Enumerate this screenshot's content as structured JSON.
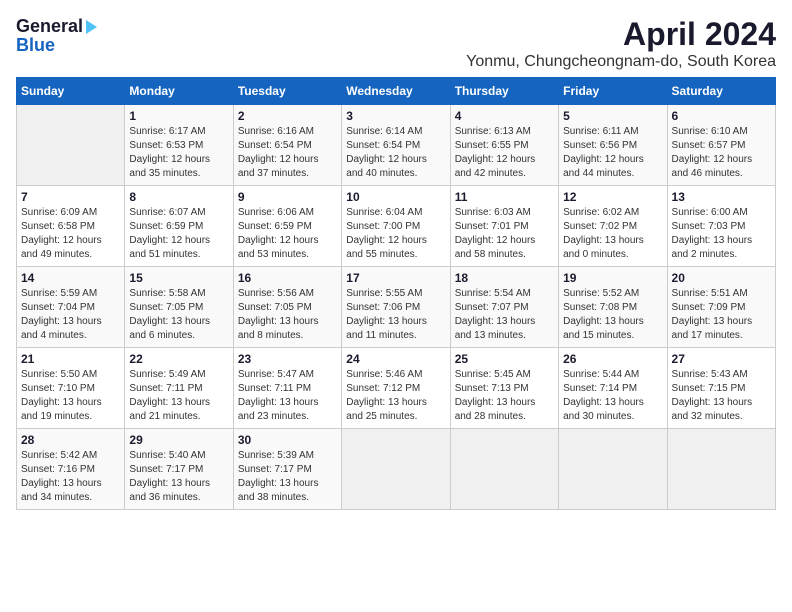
{
  "header": {
    "logo_line1": "General",
    "logo_line2": "Blue",
    "title": "April 2024",
    "subtitle": "Yonmu, Chungcheongnam-do, South Korea"
  },
  "weekdays": [
    "Sunday",
    "Monday",
    "Tuesday",
    "Wednesday",
    "Thursday",
    "Friday",
    "Saturday"
  ],
  "weeks": [
    [
      {
        "num": "",
        "info": ""
      },
      {
        "num": "1",
        "info": "Sunrise: 6:17 AM\nSunset: 6:53 PM\nDaylight: 12 hours\nand 35 minutes."
      },
      {
        "num": "2",
        "info": "Sunrise: 6:16 AM\nSunset: 6:54 PM\nDaylight: 12 hours\nand 37 minutes."
      },
      {
        "num": "3",
        "info": "Sunrise: 6:14 AM\nSunset: 6:54 PM\nDaylight: 12 hours\nand 40 minutes."
      },
      {
        "num": "4",
        "info": "Sunrise: 6:13 AM\nSunset: 6:55 PM\nDaylight: 12 hours\nand 42 minutes."
      },
      {
        "num": "5",
        "info": "Sunrise: 6:11 AM\nSunset: 6:56 PM\nDaylight: 12 hours\nand 44 minutes."
      },
      {
        "num": "6",
        "info": "Sunrise: 6:10 AM\nSunset: 6:57 PM\nDaylight: 12 hours\nand 46 minutes."
      }
    ],
    [
      {
        "num": "7",
        "info": "Sunrise: 6:09 AM\nSunset: 6:58 PM\nDaylight: 12 hours\nand 49 minutes."
      },
      {
        "num": "8",
        "info": "Sunrise: 6:07 AM\nSunset: 6:59 PM\nDaylight: 12 hours\nand 51 minutes."
      },
      {
        "num": "9",
        "info": "Sunrise: 6:06 AM\nSunset: 6:59 PM\nDaylight: 12 hours\nand 53 minutes."
      },
      {
        "num": "10",
        "info": "Sunrise: 6:04 AM\nSunset: 7:00 PM\nDaylight: 12 hours\nand 55 minutes."
      },
      {
        "num": "11",
        "info": "Sunrise: 6:03 AM\nSunset: 7:01 PM\nDaylight: 12 hours\nand 58 minutes."
      },
      {
        "num": "12",
        "info": "Sunrise: 6:02 AM\nSunset: 7:02 PM\nDaylight: 13 hours\nand 0 minutes."
      },
      {
        "num": "13",
        "info": "Sunrise: 6:00 AM\nSunset: 7:03 PM\nDaylight: 13 hours\nand 2 minutes."
      }
    ],
    [
      {
        "num": "14",
        "info": "Sunrise: 5:59 AM\nSunset: 7:04 PM\nDaylight: 13 hours\nand 4 minutes."
      },
      {
        "num": "15",
        "info": "Sunrise: 5:58 AM\nSunset: 7:05 PM\nDaylight: 13 hours\nand 6 minutes."
      },
      {
        "num": "16",
        "info": "Sunrise: 5:56 AM\nSunset: 7:05 PM\nDaylight: 13 hours\nand 8 minutes."
      },
      {
        "num": "17",
        "info": "Sunrise: 5:55 AM\nSunset: 7:06 PM\nDaylight: 13 hours\nand 11 minutes."
      },
      {
        "num": "18",
        "info": "Sunrise: 5:54 AM\nSunset: 7:07 PM\nDaylight: 13 hours\nand 13 minutes."
      },
      {
        "num": "19",
        "info": "Sunrise: 5:52 AM\nSunset: 7:08 PM\nDaylight: 13 hours\nand 15 minutes."
      },
      {
        "num": "20",
        "info": "Sunrise: 5:51 AM\nSunset: 7:09 PM\nDaylight: 13 hours\nand 17 minutes."
      }
    ],
    [
      {
        "num": "21",
        "info": "Sunrise: 5:50 AM\nSunset: 7:10 PM\nDaylight: 13 hours\nand 19 minutes."
      },
      {
        "num": "22",
        "info": "Sunrise: 5:49 AM\nSunset: 7:11 PM\nDaylight: 13 hours\nand 21 minutes."
      },
      {
        "num": "23",
        "info": "Sunrise: 5:47 AM\nSunset: 7:11 PM\nDaylight: 13 hours\nand 23 minutes."
      },
      {
        "num": "24",
        "info": "Sunrise: 5:46 AM\nSunset: 7:12 PM\nDaylight: 13 hours\nand 25 minutes."
      },
      {
        "num": "25",
        "info": "Sunrise: 5:45 AM\nSunset: 7:13 PM\nDaylight: 13 hours\nand 28 minutes."
      },
      {
        "num": "26",
        "info": "Sunrise: 5:44 AM\nSunset: 7:14 PM\nDaylight: 13 hours\nand 30 minutes."
      },
      {
        "num": "27",
        "info": "Sunrise: 5:43 AM\nSunset: 7:15 PM\nDaylight: 13 hours\nand 32 minutes."
      }
    ],
    [
      {
        "num": "28",
        "info": "Sunrise: 5:42 AM\nSunset: 7:16 PM\nDaylight: 13 hours\nand 34 minutes."
      },
      {
        "num": "29",
        "info": "Sunrise: 5:40 AM\nSunset: 7:17 PM\nDaylight: 13 hours\nand 36 minutes."
      },
      {
        "num": "30",
        "info": "Sunrise: 5:39 AM\nSunset: 7:17 PM\nDaylight: 13 hours\nand 38 minutes."
      },
      {
        "num": "",
        "info": ""
      },
      {
        "num": "",
        "info": ""
      },
      {
        "num": "",
        "info": ""
      },
      {
        "num": "",
        "info": ""
      }
    ]
  ]
}
